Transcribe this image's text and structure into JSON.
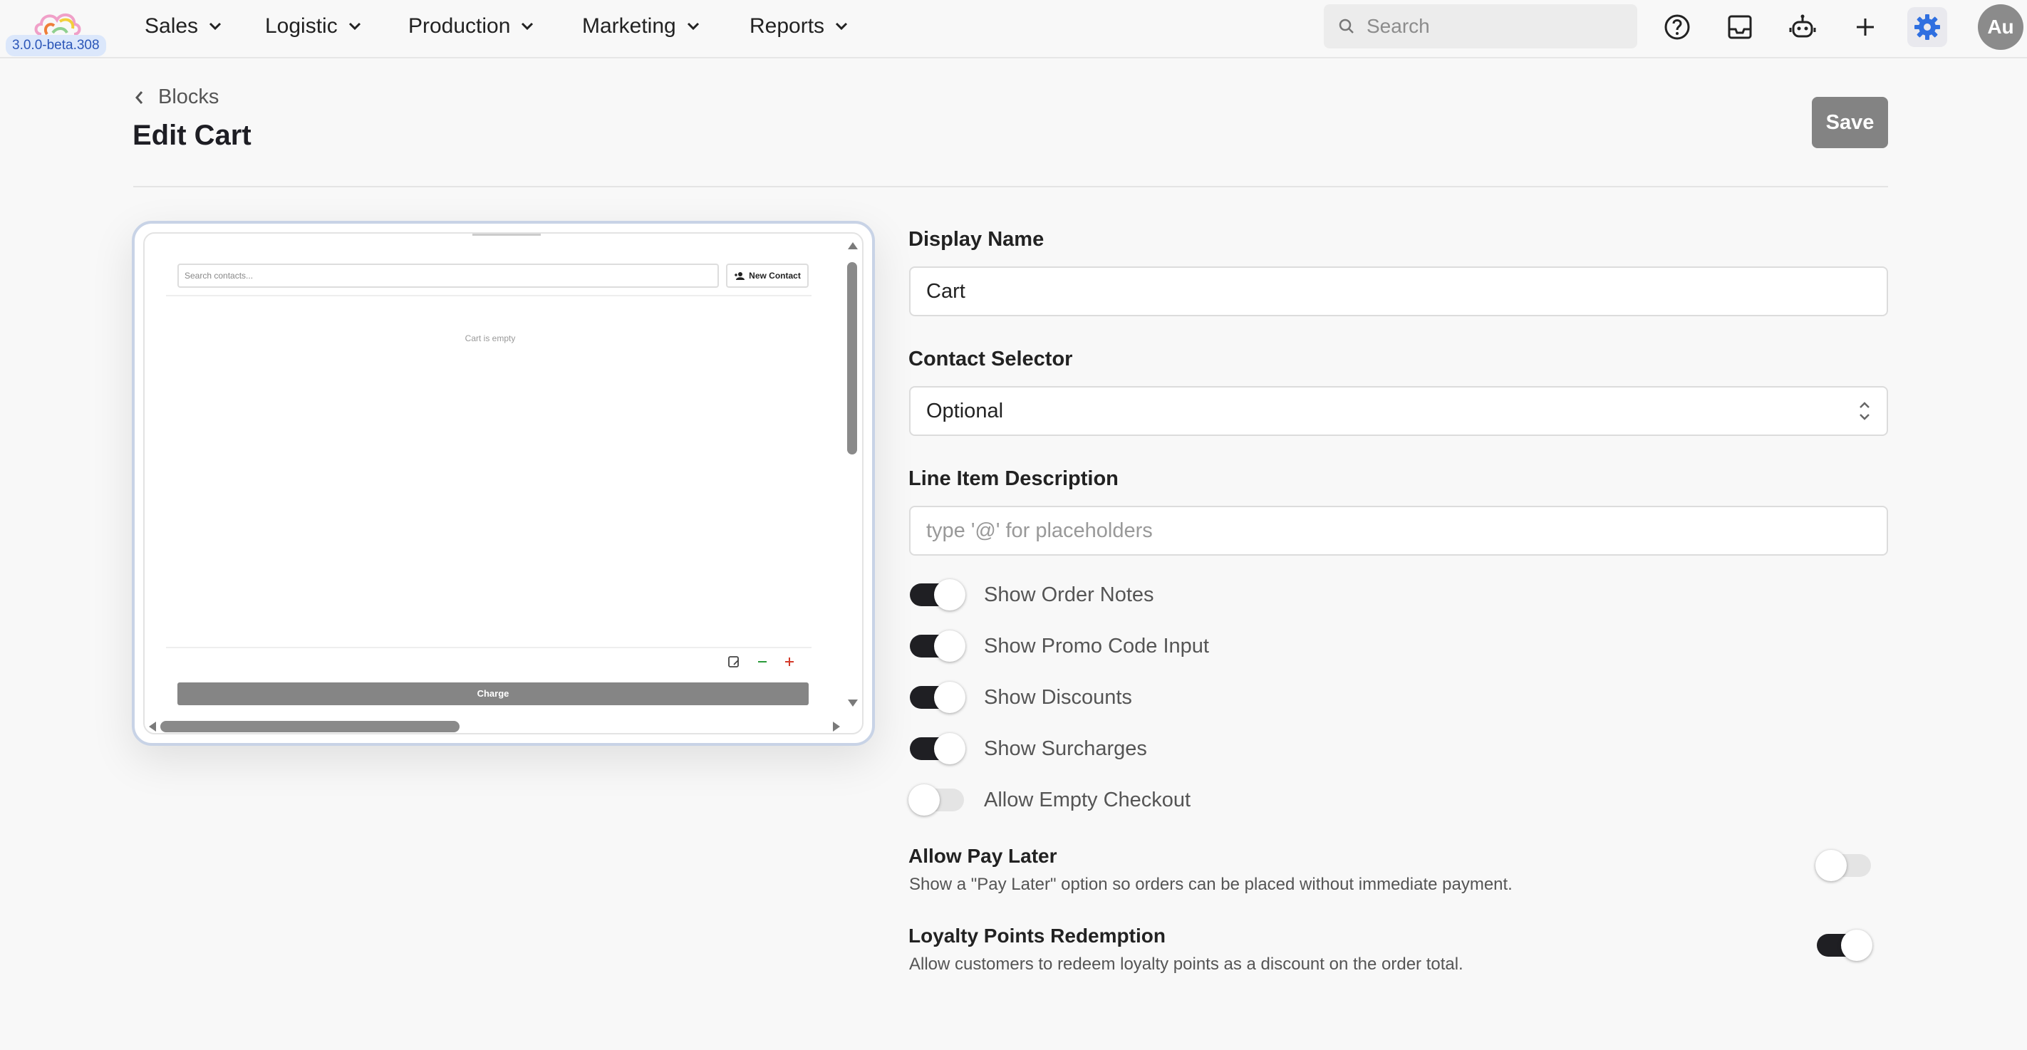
{
  "app": {
    "version": "3.0.0-beta.308",
    "avatar_initials": "Au",
    "accent": "#2f6fe0"
  },
  "nav": [
    {
      "label": "Sales"
    },
    {
      "label": "Logistic"
    },
    {
      "label": "Production"
    },
    {
      "label": "Marketing"
    },
    {
      "label": "Reports"
    }
  ],
  "search": {
    "placeholder": "Search"
  },
  "toolbar_icons": [
    "help-icon",
    "inbox-icon",
    "robot-icon",
    "plus-icon",
    "gear-icon"
  ],
  "header": {
    "back_label": "Blocks",
    "title": "Edit Cart",
    "save_label": "Save"
  },
  "preview": {
    "search_placeholder": "Search contacts...",
    "new_contact_label": "New Contact",
    "empty_text": "Cart is empty",
    "charge_label": "Charge"
  },
  "form": {
    "display_name": {
      "label": "Display Name",
      "value": "Cart"
    },
    "contact_selector": {
      "label": "Contact Selector",
      "value": "Optional"
    },
    "line_item_description": {
      "label": "Line Item Description",
      "value": "",
      "placeholder": "type '@' for placeholders"
    },
    "toggles": [
      {
        "label": "Show Order Notes",
        "on": true
      },
      {
        "label": "Show Promo Code Input",
        "on": true
      },
      {
        "label": "Show Discounts",
        "on": true
      },
      {
        "label": "Show Surcharges",
        "on": true
      },
      {
        "label": "Allow Empty Checkout",
        "on": false
      }
    ],
    "allow_pay_later": {
      "title": "Allow Pay Later",
      "description": "Show a \"Pay Later\" option so orders can be placed without immediate payment.",
      "on": false
    },
    "loyalty": {
      "title": "Loyalty Points Redemption",
      "description": "Allow customers to redeem loyalty points as a discount on the order total.",
      "on": true
    }
  }
}
